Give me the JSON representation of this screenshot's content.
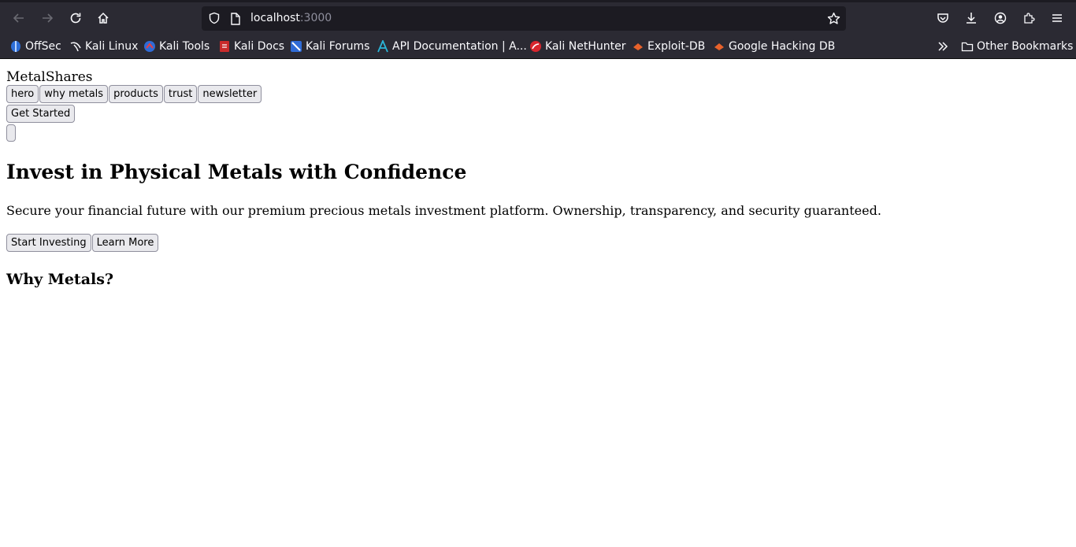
{
  "browser": {
    "url_host": "localhost",
    "url_port": ":3000",
    "bookmarks": [
      {
        "label": "OffSec",
        "icon": "offsec-icon"
      },
      {
        "label": "Kali Linux",
        "icon": "kali-dragon-icon"
      },
      {
        "label": "Kali Tools",
        "icon": "kali-tools-icon"
      },
      {
        "label": "Kali Docs",
        "icon": "kali-docs-icon"
      },
      {
        "label": "Kali Forums",
        "icon": "kali-forums-icon"
      },
      {
        "label": "API Documentation | A...",
        "icon": "api-docs-icon"
      },
      {
        "label": "Kali NetHunter",
        "icon": "nethunter-icon"
      },
      {
        "label": "Exploit-DB",
        "icon": "exploit-db-icon"
      },
      {
        "label": "Google Hacking DB",
        "icon": "ghdb-icon"
      }
    ],
    "other_bookmarks": "Other Bookmarks"
  },
  "site": {
    "brand": "MetalShares",
    "nav": [
      "hero",
      "why metals",
      "products",
      "trust",
      "newsletter"
    ],
    "get_started": "Get Started"
  },
  "hero": {
    "title": "Invest in Physical Metals with Confidence",
    "subtitle": "Secure your financial future with our premium precious metals investment platform. Ownership, transparency, and security guaranteed.",
    "primary_cta": "Start Investing",
    "secondary_cta": "Learn More"
  },
  "sections": {
    "why_title": "Why Metals?"
  },
  "colors": {
    "chrome_bg": "#2b2a33",
    "urlbar_bg": "#1c1b22",
    "button_bg": "#e9e9ed",
    "button_border": "#8f8f9d"
  }
}
